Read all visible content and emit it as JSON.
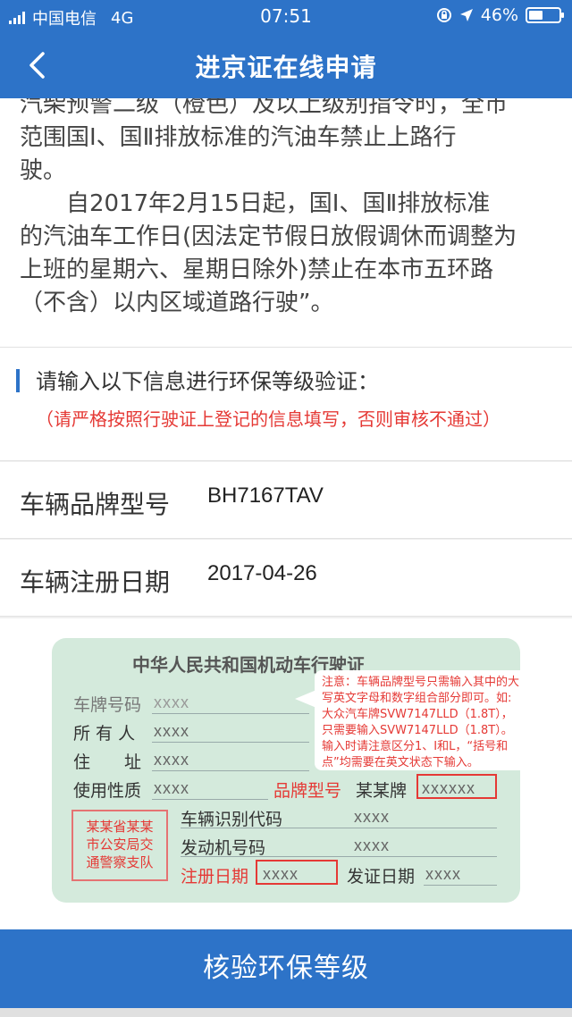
{
  "status_bar": {
    "carrier": "中国电信",
    "network": "4G",
    "time": "07:51",
    "battery": "46%",
    "battery_level": 0.46
  },
  "header": {
    "title": "进京证在线申请",
    "back_icon": "chevron-left-icon"
  },
  "intro": {
    "lines": [
      "汽柴预警二级（橙色）及以上级别指令时，全市",
      "范围国Ⅰ、国Ⅱ排放标准的汽油车禁止上路行",
      "驶。",
      "　　自2017年2月15日起，国Ⅰ、国Ⅱ排放标准",
      "的汽油车工作日(因法定节假日放假调休而调整为",
      "上班的星期六、星期日除外)禁止在本市五环路",
      "（不含）以内区域道路行驶”。"
    ]
  },
  "verify": {
    "heading": "请输入以下信息进行环保等级验证：",
    "warning": "（请严格按照行驶证上登记的信息填写，否则审核不通过）"
  },
  "fields": [
    {
      "label": "车辆品牌型号",
      "value": "BH7167TAV"
    },
    {
      "label": "车辆注册日期",
      "value": "2017-04-26"
    }
  ],
  "license": {
    "title": "中华人民共和国机动车行驶证",
    "plate_label": "车牌号码",
    "owner_label": "所 有 人",
    "address_label": "住　　址",
    "usage_label": "使用性质",
    "brand_label": "品牌型号",
    "brand_value": "某某牌",
    "vin_label": "车辆识别代码",
    "engine_label": "发动机号码",
    "reg_date_label": "注册日期",
    "issue_date_label": "发证日期",
    "placeholder": "xxxx",
    "placeholder_long": "xxxxxx",
    "stamp_lines": [
      "某某省某某",
      "市公安局交",
      "通警察支队"
    ]
  },
  "note": {
    "lines": [
      "注意：车辆品牌型号只需输入其中的大",
      "写英文字母和数字组合部分即可。如:",
      "大众汽车牌SVW7147LLD（1.8T），",
      "只需要输入SVW7147LLD（1.8T）。",
      "输入时请注意区分1、I和L，“括号和",
      "点”均需要在英文状态下输入。"
    ]
  },
  "action": {
    "submit_label": "核验环保等级"
  },
  "colors": {
    "primary": "#2d73c8",
    "warning": "#e53935",
    "license_bg": "#d4eadc"
  }
}
